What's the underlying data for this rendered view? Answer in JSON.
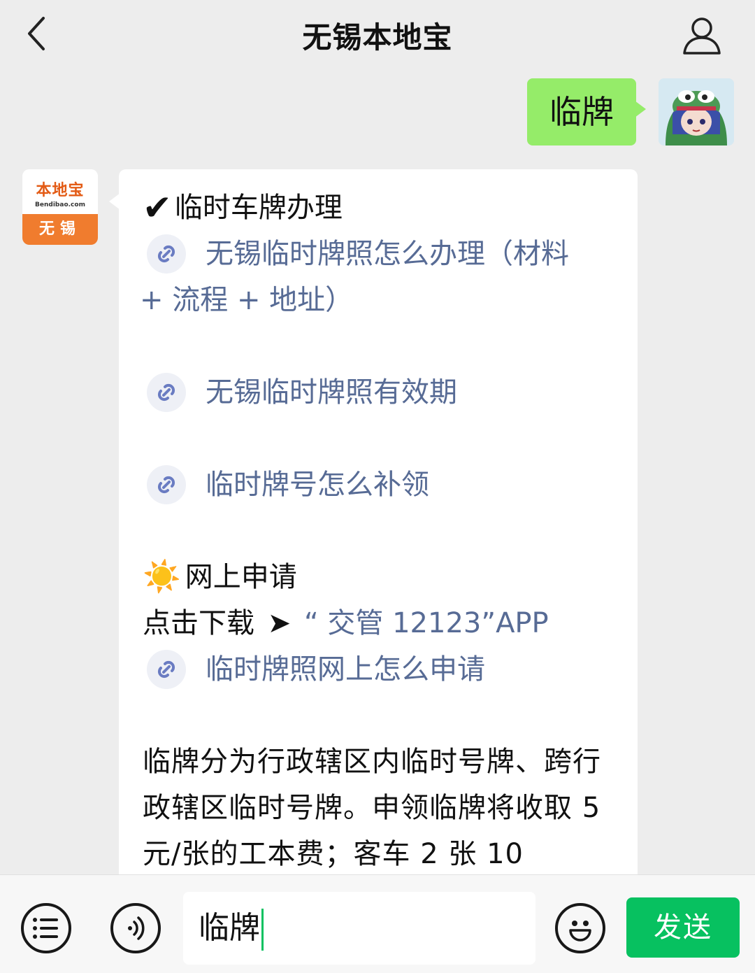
{
  "header": {
    "title": "无锡本地宝"
  },
  "outgoing": {
    "message": "临牌"
  },
  "bot": {
    "logo_main": "本地宝",
    "logo_sub": "Bendibao.com",
    "logo_city": "无锡"
  },
  "reply": {
    "heading_check": "✔",
    "heading": "临时车牌办理",
    "link1_line1": "无锡临时牌照怎么办理（材料",
    "link1_line2": "+ 流程 + 地址）",
    "link2": "无锡临时牌照有效期",
    "link3": "临时牌号怎么补领",
    "section_icon": "☀️",
    "section_title": "网上申请",
    "download_prefix": "点击下载",
    "download_arrow": "➤",
    "download_link": "“ 交管 12123”APP",
    "link4": "临时牌照网上怎么申请",
    "paragraph": "临牌分为行政辖区内临时号牌、跨行政辖区临时号牌。申领临牌将收取 5 元/张的工本费；客车 2 张 10"
  },
  "input": {
    "value": "临牌"
  },
  "buttons": {
    "send": "发送"
  },
  "colors": {
    "accent_green": "#07c160",
    "bubble_green": "#95ec69",
    "link_blue": "#576b95"
  },
  "icons": [
    "back-icon",
    "user-icon",
    "link-icon",
    "menu-icon",
    "voice-icon",
    "emoji-icon"
  ]
}
